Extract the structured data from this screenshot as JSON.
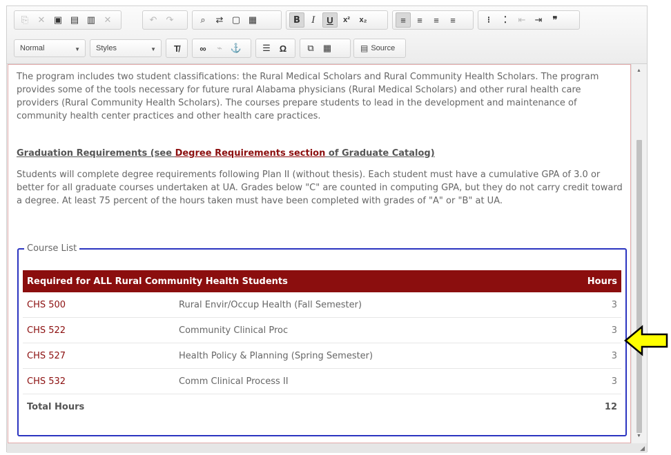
{
  "toolbar": {
    "row1": [
      {
        "name": "copy-icon",
        "glyph": "⎘",
        "state": "disabled"
      },
      {
        "name": "cut-icon",
        "glyph": "✕",
        "state": "disabled"
      },
      {
        "name": "paste-icon",
        "glyph": "▣",
        "state": "normal"
      },
      {
        "name": "paste-text-icon",
        "glyph": "▤",
        "state": "normal"
      },
      {
        "name": "paste-word-icon",
        "glyph": "▥",
        "state": "normal"
      },
      {
        "name": "remove-icon",
        "glyph": "✕",
        "state": "disabled"
      },
      {
        "name": "undo-icon",
        "glyph": "↶",
        "state": "disabled"
      },
      {
        "name": "redo-icon",
        "glyph": "↷",
        "state": "disabled"
      },
      {
        "name": "find-icon",
        "glyph": "⌕",
        "state": "normal"
      },
      {
        "name": "replace-icon",
        "glyph": "⇄",
        "state": "normal"
      },
      {
        "name": "select-all-icon",
        "glyph": "▢",
        "state": "normal"
      },
      {
        "name": "spellcheck-icon",
        "glyph": "▦",
        "state": "normal"
      },
      {
        "name": "bold-icon",
        "glyph": "B",
        "state": "on"
      },
      {
        "name": "italic-icon",
        "glyph": "I",
        "state": "normal"
      },
      {
        "name": "underline-icon",
        "glyph": "U",
        "state": "on"
      },
      {
        "name": "superscript-icon",
        "glyph": "x²",
        "state": "normal"
      },
      {
        "name": "subscript-icon",
        "glyph": "x₂",
        "state": "normal"
      },
      {
        "name": "align-left-icon",
        "glyph": "≡",
        "state": "on"
      },
      {
        "name": "align-center-icon",
        "glyph": "≡",
        "state": "normal"
      },
      {
        "name": "align-right-icon",
        "glyph": "≡",
        "state": "normal"
      },
      {
        "name": "justify-icon",
        "glyph": "≡",
        "state": "normal"
      },
      {
        "name": "numbered-list-icon",
        "glyph": "⁝",
        "state": "normal"
      },
      {
        "name": "bulleted-list-icon",
        "glyph": "⁚",
        "state": "normal"
      },
      {
        "name": "outdent-icon",
        "glyph": "⇤",
        "state": "disabled"
      },
      {
        "name": "indent-icon",
        "glyph": "⇥",
        "state": "normal"
      },
      {
        "name": "blockquote-icon",
        "glyph": "❞",
        "state": "normal"
      }
    ],
    "format_select": "Normal",
    "styles_select": "Styles",
    "row2": [
      {
        "name": "remove-format-icon",
        "glyph": "T̸"
      },
      {
        "name": "link-icon",
        "glyph": "∞"
      },
      {
        "name": "unlink-icon",
        "glyph": "⌁"
      },
      {
        "name": "anchor-icon",
        "glyph": "⚓"
      },
      {
        "name": "horizontal-rule-icon",
        "glyph": "☰"
      },
      {
        "name": "special-char-icon",
        "glyph": "Ω"
      },
      {
        "name": "embed-icon",
        "glyph": "⧉"
      },
      {
        "name": "table-icon",
        "glyph": "▦"
      }
    ],
    "source_label": "Source"
  },
  "content": {
    "para1": "The program includes two student classifications: the Rural Medical Scholars and Rural Community Health Scholars. The program provides some of the tools necessary for future rural Alabama physicians (Rural Medical Scholars) and other rural health care providers (Rural Community Health Scholars). The courses prepare students to lead in the development and maintenance of community health center practices and other health care practices.",
    "grad_prefix": "Graduation Requirements (see ",
    "grad_link": "Degree Requirements section",
    "grad_suffix": " of Graduate Catalog)",
    "para2": "Students will complete degree requirements following Plan II (without thesis).  Each student must have a cumulative GPA of 3.0 or better for all graduate courses undertaken at UA.  Grades below \"C\" are counted in computing GPA, but they do not carry credit toward a degree.  At least 75 percent of the hours taken must have been completed with grades of \"A\" or \"B\" at UA."
  },
  "course_list": {
    "legend": "Course List",
    "header_title": "Required for ALL Rural Community Health Students",
    "header_hours": "Hours",
    "rows": [
      {
        "code": "CHS 500",
        "title": "Rural Envir/Occup Health (Fall Semester)",
        "hours": "3"
      },
      {
        "code": "CHS 522",
        "title": "Community Clinical Proc",
        "hours": "3"
      },
      {
        "code": "CHS 527",
        "title": "Health Policy & Planning (Spring Semester)",
        "hours": "3"
      },
      {
        "code": "CHS 532",
        "title": "Comm Clinical Process II",
        "hours": "3"
      }
    ],
    "total_label": "Total Hours",
    "total_hours": "12"
  },
  "colors": {
    "accent": "#8b0e0e",
    "fieldset_border": "#2a33c0",
    "callout_fill": "#ffff00"
  }
}
